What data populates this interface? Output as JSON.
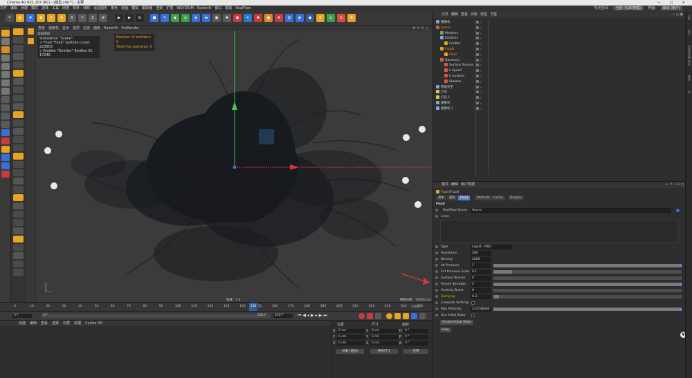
{
  "titlebar": {
    "title": "Cinema 4D R21.207 (RC) - [模型.c4d *] - 主要",
    "controls": "— ◻ ✕"
  },
  "menu": {
    "items": [
      "文件",
      "编辑",
      "创建",
      "模式",
      "选择",
      "工具",
      "网格",
      "样条",
      "体积",
      "运动图形",
      "角色",
      "动画",
      "模拟",
      "跟踪器",
      "渲染",
      "扩展",
      "INSYDIUM",
      "Redshift",
      "窗口",
      "帮助",
      "RealFlow"
    ],
    "node_space_label": "节点空间:",
    "node_space_value": "当前 (标准/物理)",
    "layout_label": "界面:",
    "layout_value": "启动 (用户)"
  },
  "toolbar": {
    "buttons": [
      {
        "name": "undo-icon",
        "glyph": "↶"
      },
      {
        "name": "live-select-icon",
        "glyph": "◉"
      },
      {
        "name": "move-icon",
        "glyph": "✥"
      },
      {
        "name": "scale-icon",
        "glyph": "▣"
      },
      {
        "name": "rotate-icon",
        "glyph": "⟳"
      },
      {
        "name": "recent-icon",
        "glyph": "✚"
      },
      {
        "name": "x-axis-icon",
        "glyph": "X"
      },
      {
        "name": "y-axis-icon",
        "glyph": "Y"
      },
      {
        "name": "z-axis-icon",
        "glyph": "Z"
      },
      {
        "name": "coord-system-icon",
        "glyph": "⊕"
      },
      {
        "name": "render-view-icon",
        "glyph": "▶"
      },
      {
        "name": "render-picture-viewer-icon",
        "glyph": "▶"
      },
      {
        "name": "render-settings-icon",
        "glyph": "⚙"
      },
      {
        "name": "cube-icon",
        "glyph": "■"
      },
      {
        "name": "pen-icon",
        "glyph": "✎"
      },
      {
        "name": "subdivision-icon",
        "glyph": "◆"
      },
      {
        "name": "array-icon",
        "glyph": "◎"
      },
      {
        "name": "deformer-icon",
        "glyph": "◈"
      },
      {
        "name": "floor-icon",
        "glyph": "▬"
      },
      {
        "name": "camera-icon",
        "glyph": "▣"
      },
      {
        "name": "light-icon",
        "glyph": "✹"
      },
      {
        "name": "redshift-icon",
        "glyph": "▣"
      },
      {
        "name": "xp-icon",
        "glyph": "✦"
      },
      {
        "name": "rs-light-icon",
        "glyph": "✹"
      },
      {
        "name": "rs-material-icon",
        "glyph": "●"
      },
      {
        "name": "rs-cam-icon",
        "glyph": "✚"
      },
      {
        "name": "rs-ipr-icon",
        "glyph": "▥"
      },
      {
        "name": "rs-render-icon",
        "glyph": "◉"
      },
      {
        "name": "rf-scene-icon",
        "glyph": "●"
      },
      {
        "name": "rf-emitter-icon",
        "glyph": "B"
      },
      {
        "name": "rf-daemon-icon",
        "glyph": "◎"
      },
      {
        "name": "rf-sim-icon",
        "glyph": "S"
      },
      {
        "name": "rf-mesh-icon",
        "glyph": "✺"
      }
    ]
  },
  "viewport": {
    "menu": [
      "查看",
      "摄像机",
      "显示",
      "选项",
      "过滤",
      "面板",
      "Redshift",
      "ProRender"
    ],
    "view_label": "透视视图",
    "sim_title": "Simulation \"Scene\":",
    "sim_line1": "> Fluid \"Fluid\" particle count: 223903",
    "sim_line2": "> Emitter \"Emitter\" Emitter ID: 17246",
    "emitters": "Number of emitters: 0",
    "fluid_particles": "Total live particles: 0",
    "speed": "帧速 : 1.0",
    "grid": "网格间距 : 10000 cm"
  },
  "timeline": {
    "ticks": [
      "0",
      "10",
      "20",
      "30",
      "40",
      "50",
      "60",
      "70",
      "80",
      "90",
      "100",
      "110",
      "120",
      "130",
      "140",
      "150",
      "160",
      "170",
      "180",
      "190",
      "200",
      "210",
      "220",
      "230",
      "240",
      "250"
    ],
    "current": "150",
    "end": "150 F"
  },
  "playback": {
    "start": "0 F",
    "preview_start": "0 F",
    "preview_end": "250 F",
    "end": "250 F"
  },
  "bottom": {
    "menu": [
      "创建",
      "编辑",
      "查看",
      "选择",
      "材质",
      "纹理",
      "Cycles 4D"
    ]
  },
  "coords": {
    "headers": [
      "位置",
      "尺寸",
      "旋转"
    ],
    "rows": [
      {
        "axis": "X",
        "pos": "0 cm",
        "size": "0 cm",
        "rot_axis": "H",
        "rot": "0 °"
      },
      {
        "axis": "Y",
        "pos": "0 cm",
        "size": "0 cm",
        "rot_axis": "P",
        "rot": "0 °"
      },
      {
        "axis": "Z",
        "pos": "0 cm",
        "size": "0 cm",
        "rot_axis": "B",
        "rot": "0 °"
      }
    ],
    "mode1": "对象 (相对)",
    "mode2": "绝对尺寸",
    "apply": "应用"
  },
  "objects": {
    "menu": [
      "文件",
      "编辑",
      "查看",
      "对象",
      "标签",
      "书签"
    ],
    "items": [
      {
        "label": "摄像机",
        "indent": 0,
        "color": "#7fa7d9",
        "orange": false
      },
      {
        "label": "Scene",
        "indent": 0,
        "color": "#d9594a",
        "orange": true
      },
      {
        "label": "Meshers",
        "indent": 1,
        "color": "#5fae62",
        "orange": false
      },
      {
        "label": "Emitters",
        "indent": 1,
        "color": "#7fa7d9",
        "orange": false
      },
      {
        "label": "Emitter",
        "indent": 2,
        "color": "#e6a423",
        "orange": false
      },
      {
        "label": "Fluids",
        "indent": 1,
        "color": "#e6a423",
        "orange": true
      },
      {
        "label": "Fluid",
        "indent": 2,
        "color": "#e6a423",
        "orange": true
      },
      {
        "label": "Daemons",
        "indent": 1,
        "color": "#d9594a",
        "orange": false
      },
      {
        "label": "Surface Tension",
        "indent": 2,
        "color": "#d9594a",
        "orange": false
      },
      {
        "label": "k Speed",
        "indent": 2,
        "color": "#d9594a",
        "orange": false
      },
      {
        "label": "k Isolated",
        "indent": 2,
        "color": "#d9594a",
        "orange": false
      },
      {
        "label": "Sheeter",
        "indent": 2,
        "color": "#d9594a",
        "orange": false
      },
      {
        "label": "物理天空",
        "indent": 0,
        "color": "#7fa7d9",
        "orange": false
      },
      {
        "label": "灯光",
        "indent": 0,
        "color": "#d9c94a",
        "orange": false
      },
      {
        "label": "灯光.1",
        "indent": 0,
        "color": "#d9c94a",
        "orange": false
      },
      {
        "label": "摄像机",
        "indent": 0,
        "color": "#7fa7d9",
        "orange": false
      },
      {
        "label": "摄像机.1",
        "indent": 0,
        "color": "#7fa7d9",
        "orange": false
      }
    ]
  },
  "attributes": {
    "menu": [
      "模式",
      "编辑",
      "用户数据"
    ],
    "object_title": "Fluid [Fluid]",
    "tabs": [
      "基本",
      "坐标",
      "Fluid",
      "Particles",
      "Cache",
      "Display"
    ],
    "active_tab": "Fluid",
    "section": "Fluid",
    "scene_label": "RealFlow Scene",
    "scene_value": "Scene",
    "links_label": "Links",
    "type_label": "Type",
    "type_value": "Liquid - PBD",
    "params": [
      {
        "label": "Resolution",
        "value": "200",
        "orange": false,
        "fill": 0,
        "slider": false
      },
      {
        "label": "Density",
        "value": "1000",
        "orange": false,
        "fill": 0,
        "slider": false
      },
      {
        "label": "Int Pressure",
        "value": "1",
        "orange": false,
        "fill": 1,
        "slider": true
      },
      {
        "label": "Ext Pressure Scale",
        "value": "0.1",
        "orange": false,
        "fill": 0.1,
        "slider": true
      },
      {
        "label": "Surface Tension",
        "value": "0",
        "orange": false,
        "fill": 0,
        "slider": true
      },
      {
        "label": "Tensile Strength",
        "value": "2",
        "orange": false,
        "fill": 1,
        "slider": true
      },
      {
        "label": "Vorticity Boost",
        "value": "0",
        "orange": false,
        "fill": 0,
        "slider": true
      },
      {
        "label": "Damping",
        "value": "0.3",
        "orange": true,
        "fill": 0.03,
        "slider": true
      }
    ],
    "compute_vorticity": "Compute Vorticity",
    "max_particles_label": "Max Particles",
    "max_particles_value": "214748364",
    "use_initial_state": "Use Initial State",
    "create_initial_state": "Create Initial State",
    "help": "Help"
  },
  "rightstrip": {
    "labels": [
      "对象",
      "场次",
      "内容浏览器",
      "构造",
      "属性",
      "层"
    ]
  }
}
